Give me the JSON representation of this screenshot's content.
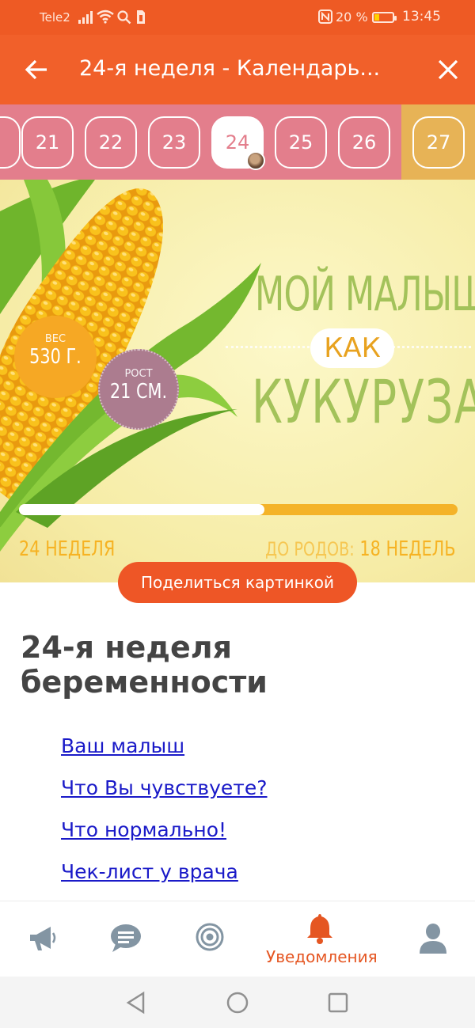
{
  "status_bar": {
    "carrier": "Tele2",
    "battery_percent": "20 %",
    "time": "13:45"
  },
  "app_bar": {
    "title": "24-я неделя - Календарь...",
    "back_icon": "arrow-left-icon",
    "close_icon": "close-icon"
  },
  "weeks": {
    "items": [
      "21",
      "22",
      "23",
      "24",
      "25",
      "26",
      "27"
    ],
    "selected": "24"
  },
  "hero": {
    "title_line1": "МОЙ МАЛЫШ",
    "title_kak": "КАК",
    "title_line2": "КУКУРУЗА",
    "weight_label": "ВЕС",
    "weight_value": "530 Г.",
    "height_label": "РОСТ",
    "height_value": "21 СМ.",
    "progress_fraction": 0.56,
    "week_label": "24 НЕДЕЛЯ",
    "until_label": "ДО РОДОВ:",
    "until_value": "18 НЕДЕЛЬ"
  },
  "share_button": "Поделиться картинкой",
  "article": {
    "title": "24-я неделя беременности",
    "links": [
      "Ваш малыш",
      "Что Вы чувствуете?",
      "Что нормально!",
      "Чек-лист у врача"
    ]
  },
  "bottom_nav": {
    "items": [
      {
        "icon": "megaphone-icon"
      },
      {
        "icon": "chat-bubble-icon"
      },
      {
        "icon": "target-icon"
      },
      {
        "icon": "bell-icon",
        "label": "Уведомления",
        "active": true
      },
      {
        "icon": "person-icon"
      }
    ],
    "active_color": "#e55622",
    "inactive_color": "#8395a3"
  },
  "colors": {
    "accent": "#f1602a",
    "week_strip": "#e37e8c",
    "link": "#1a1ac8"
  }
}
